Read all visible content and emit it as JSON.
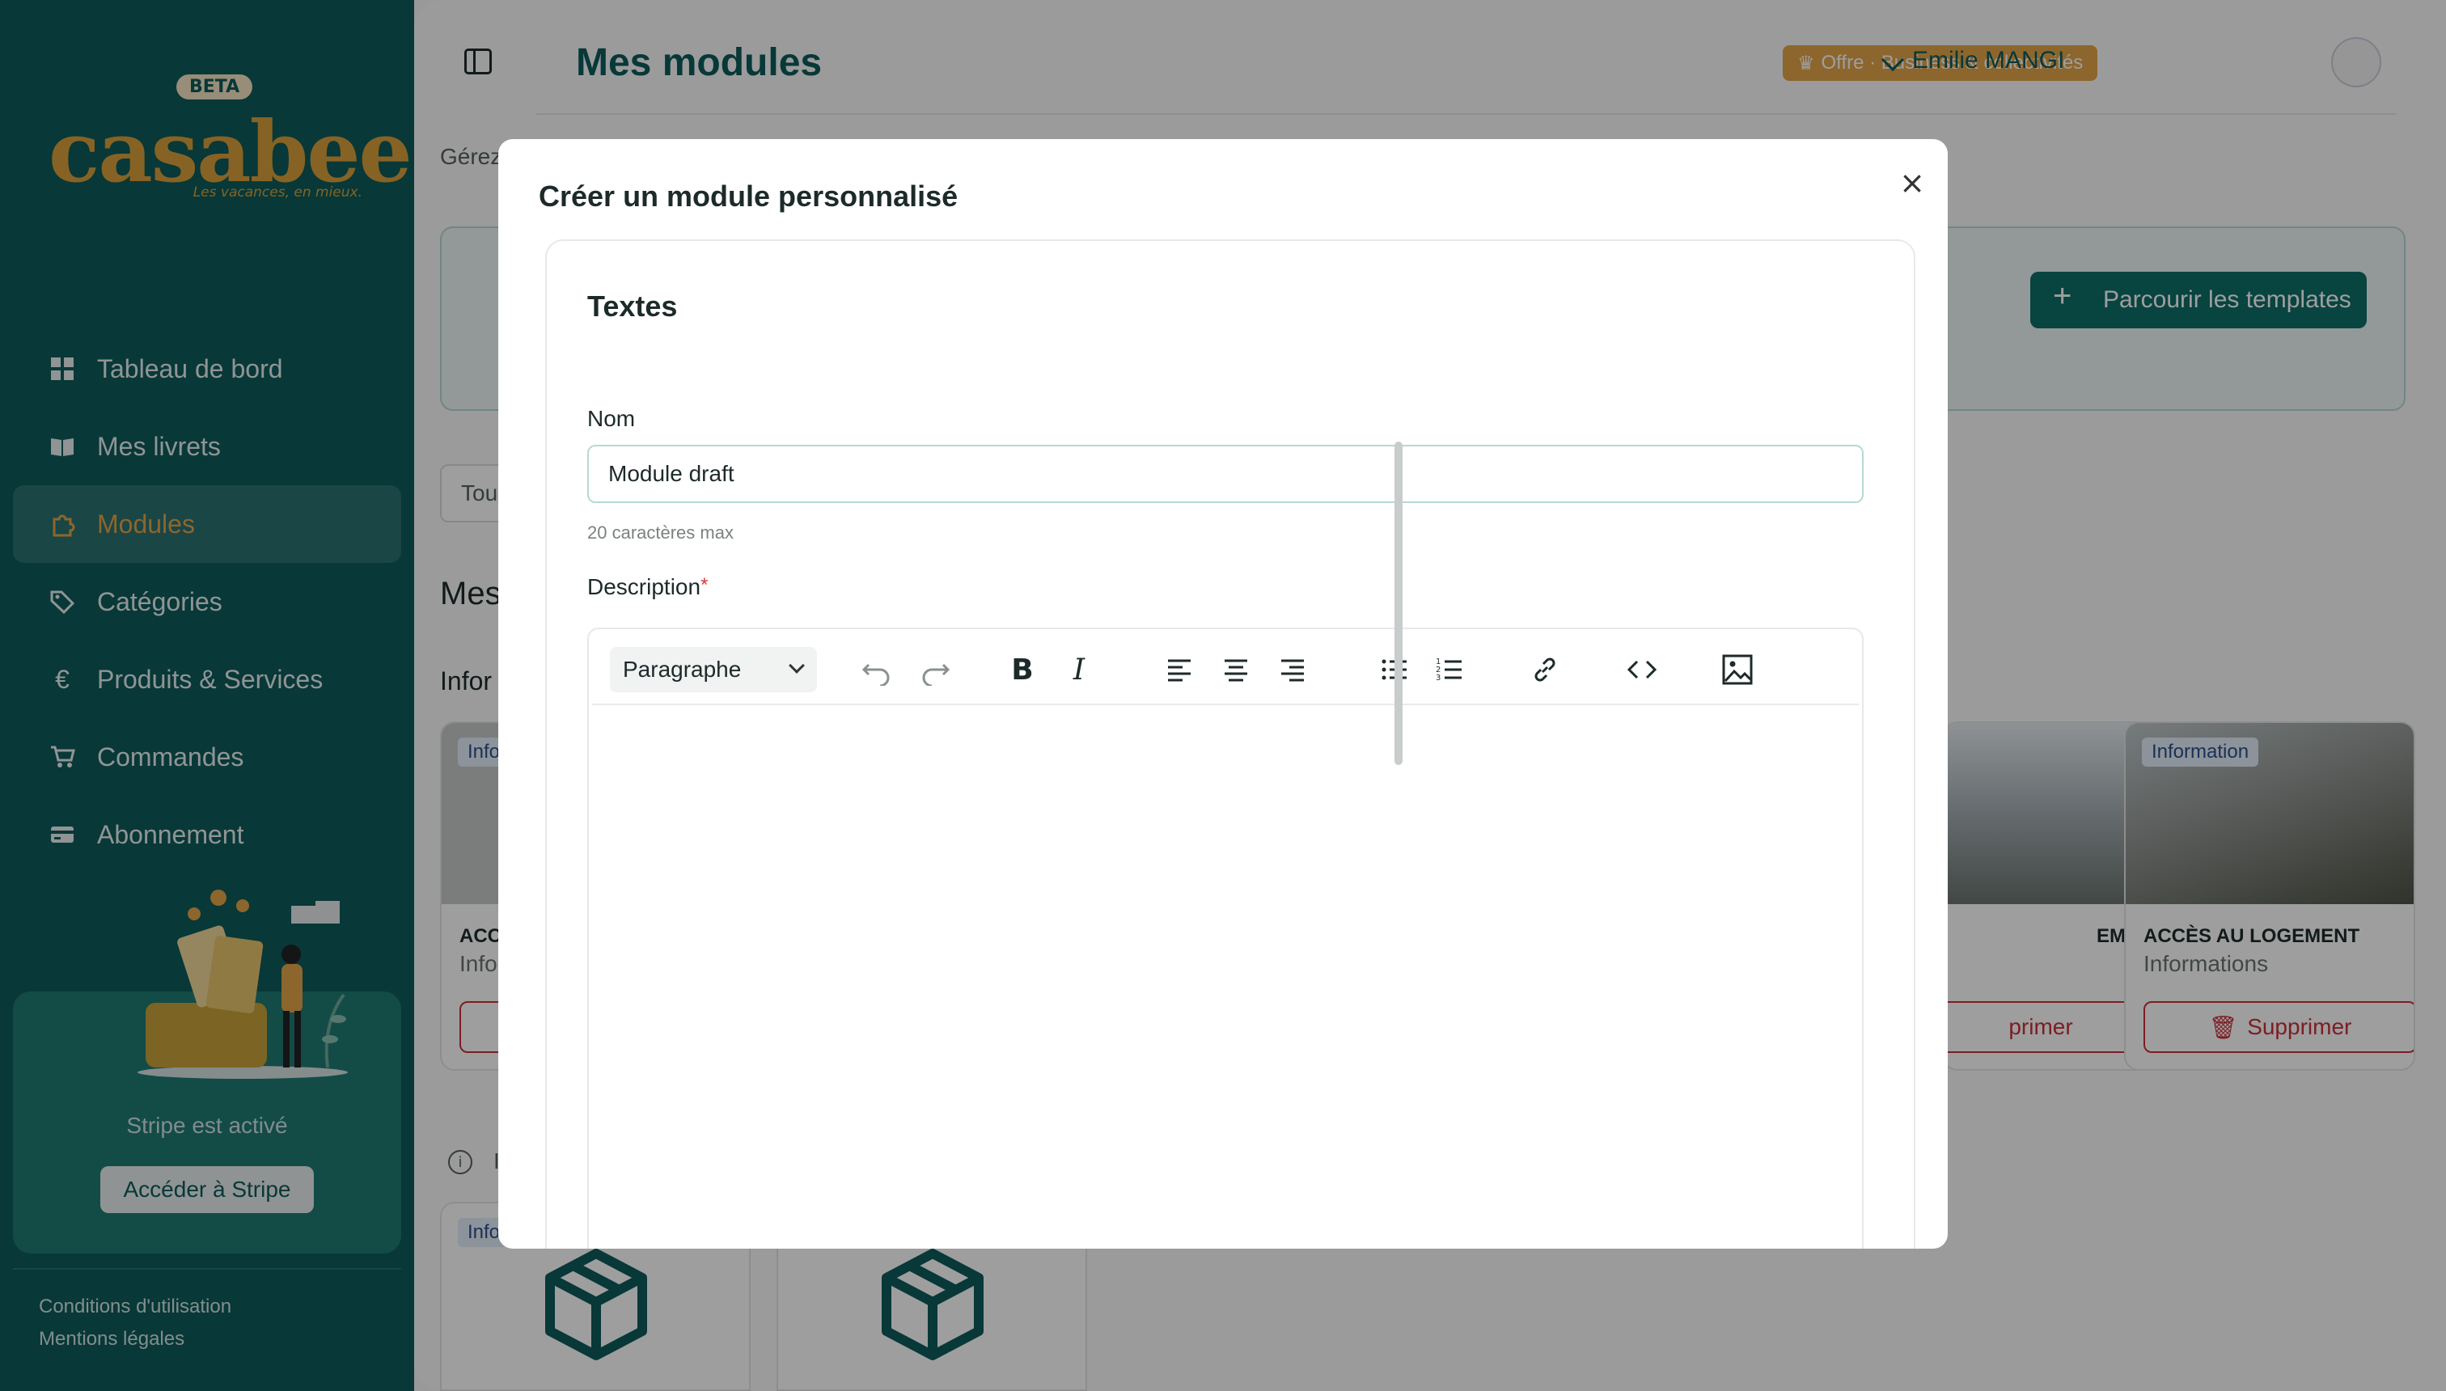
{
  "sidebar": {
    "beta": "BETA",
    "logo": "casabee",
    "tagline": "Les vacances, en mieux.",
    "items": [
      {
        "label": "Tableau de bord",
        "icon": "grid-icon"
      },
      {
        "label": "Mes livrets",
        "icon": "book-icon"
      },
      {
        "label": "Modules",
        "icon": "puzzle-icon",
        "active": true
      },
      {
        "label": "Catégories",
        "icon": "tags-icon"
      },
      {
        "label": "Produits & Services",
        "icon": "euro-icon"
      },
      {
        "label": "Commandes",
        "icon": "cart-icon"
      },
      {
        "label": "Abonnement",
        "icon": "card-icon"
      }
    ],
    "stripe_text": "Stripe est activé",
    "stripe_button": "Accéder à Stripe",
    "footer": [
      "Conditions d'utilisation",
      "Mentions légales"
    ]
  },
  "header": {
    "title": "Mes modules",
    "offer": "Offre · Business & collectivités",
    "user": "Emilie MANGI"
  },
  "background": {
    "subtitle_fragment": "Gérez",
    "templates_button": "Parcourir les templates",
    "filter_fragment": "Tou",
    "section_fragment": "Mes",
    "subsection_fragment": "Infor",
    "badge": "Information",
    "badge_fragment": "Info",
    "card_left_title": "ACC",
    "card_left_sub": "Info",
    "card_mid_title": "EMENT",
    "card_mid_del": "primer",
    "card_right_title": "ACCÈS AU LOGEMENT",
    "card_right_sub": "Informations",
    "delete_label": "Supprimer",
    "info_fragment": "I"
  },
  "modal": {
    "title": "Créer un module personnalisé",
    "section_title": "Textes",
    "name_label": "Nom",
    "name_value": "Module draft",
    "name_hint": "20 caractères max",
    "description_label": "Description",
    "required_mark": "*",
    "paragraph_select": "Paragraphe"
  },
  "colors": {
    "brand_teal": "#0e5b5b",
    "accent_gold": "#e2a54a",
    "danger": "#c9303a"
  }
}
